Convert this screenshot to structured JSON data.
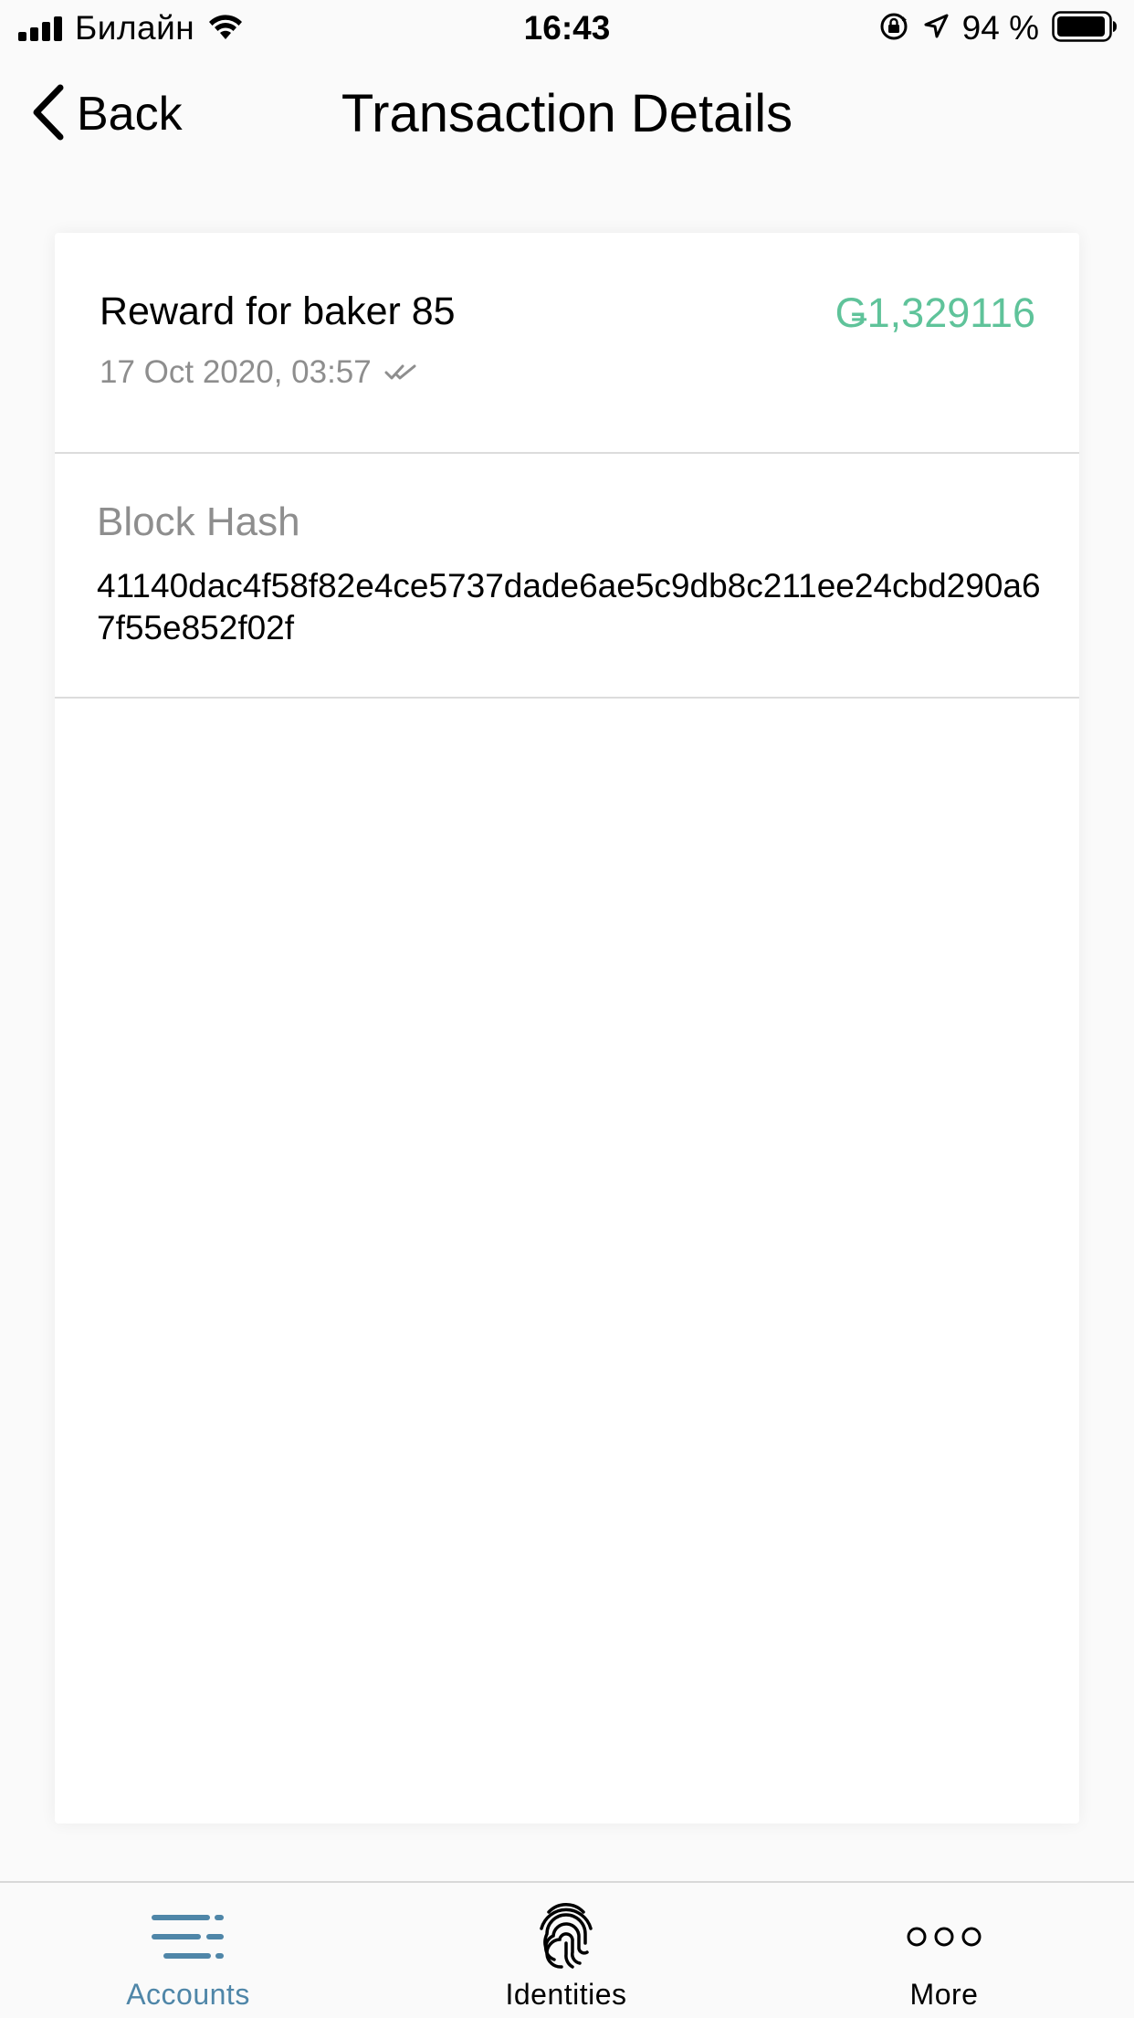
{
  "status_bar": {
    "carrier": "Билайн",
    "time": "16:43",
    "battery_percent": "94 %",
    "icons": [
      "signal-icon",
      "wifi-icon",
      "rotation-lock-icon",
      "location-icon",
      "battery-icon"
    ]
  },
  "nav": {
    "back_label": "Back",
    "title": "Transaction Details"
  },
  "transaction": {
    "title": "Reward for baker 85",
    "amount": "Ǥ1,329116",
    "amount_color": "#5fc39a",
    "date": "17 Oct 2020, 03:57",
    "status_icon": "double-check-icon"
  },
  "block_hash": {
    "label": "Block Hash",
    "value": "41140dac4f58f82e4ce5737dade6ae5c9db8c211ee24cbd290a67f55e852f02f"
  },
  "tab_bar": {
    "active_color": "#4f86a8",
    "tabs": [
      {
        "label": "Accounts",
        "icon": "accounts-list-icon",
        "active": true
      },
      {
        "label": "Identities",
        "icon": "fingerprint-icon",
        "active": false
      },
      {
        "label": "More",
        "icon": "more-dots-icon",
        "active": false
      }
    ]
  }
}
